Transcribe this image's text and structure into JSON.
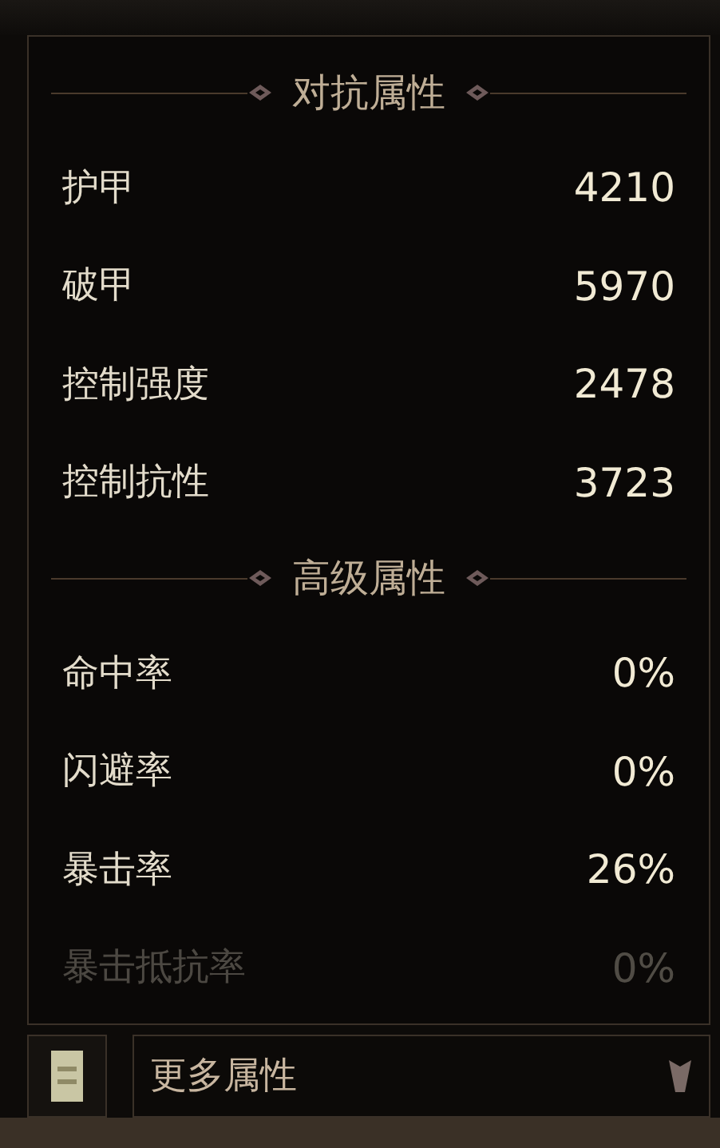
{
  "sections": [
    {
      "title": "对抗属性",
      "rows": [
        {
          "label": "护甲",
          "value": "4210",
          "dimmed": false
        },
        {
          "label": "破甲",
          "value": "5970",
          "dimmed": false
        },
        {
          "label": "控制强度",
          "value": "2478",
          "dimmed": false
        },
        {
          "label": "控制抗性",
          "value": "3723",
          "dimmed": false
        }
      ]
    },
    {
      "title": "高级属性",
      "rows": [
        {
          "label": "命中率",
          "value": "0%",
          "dimmed": false
        },
        {
          "label": "闪避率",
          "value": "0%",
          "dimmed": false
        },
        {
          "label": "暴击率",
          "value": "26%",
          "dimmed": false
        },
        {
          "label": "暴击抵抗率",
          "value": "0%",
          "dimmed": true
        }
      ]
    }
  ],
  "dropdown": {
    "value": "更多属性"
  }
}
